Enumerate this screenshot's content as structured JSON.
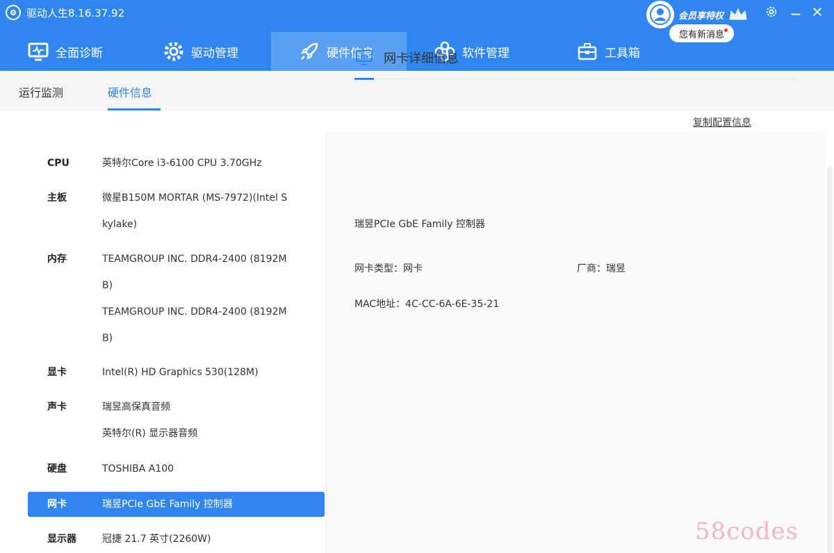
{
  "app": {
    "title": "驱动人生8.16.37.92"
  },
  "user": {
    "member_label": "会员享特权",
    "message": "您有新消息"
  },
  "main_tabs": [
    {
      "label": "全面诊断",
      "icon": "monitor-icon"
    },
    {
      "label": "驱动管理",
      "icon": "gear-icon"
    },
    {
      "label": "硬件信息",
      "icon": "rocket-icon"
    },
    {
      "label": "软件管理",
      "icon": "clover-icon"
    },
    {
      "label": "工具箱",
      "icon": "toolbox-icon"
    }
  ],
  "sub_tabs": [
    {
      "label": "运行监测"
    },
    {
      "label": "硬件信息"
    }
  ],
  "copy_config": "复制配置信息",
  "hardware": [
    {
      "label": "CPU",
      "lines": [
        "英特尔Core i3-6100 CPU 3.70GHz"
      ]
    },
    {
      "label": "主板",
      "lines": [
        "微星B150M MORTAR (MS-7972)(Intel S",
        "kylake)"
      ]
    },
    {
      "label": "内存",
      "lines": [
        "TEAMGROUP INC. DDR4-2400 (8192M",
        "B)",
        "TEAMGROUP INC. DDR4-2400 (8192M",
        "B)"
      ]
    },
    {
      "label": "显卡",
      "lines": [
        "Intel(R) HD Graphics 530(128M)"
      ]
    },
    {
      "label": "声卡",
      "lines": [
        "瑞昱高保真音频",
        "英特尔(R) 显示器音频"
      ]
    },
    {
      "label": "硬盘",
      "lines": [
        "TOSHIBA A100"
      ]
    },
    {
      "label": "网卡",
      "lines": [
        "瑞昱PCIe GbE Family 控制器"
      ],
      "active": true
    },
    {
      "label": "显示器",
      "lines": [
        "冠捷 21.7 英寸(2260W)"
      ]
    }
  ],
  "detail": {
    "heading": "网卡详细信息",
    "device_name": "瑞昱PCIe GbE Family 控制器",
    "type": "网卡类型：网卡",
    "vendor": "厂商：瑞昱",
    "mac": "MAC地址：4C-CC-6A-6E-35-21"
  },
  "watermark": "58codes",
  "colors": {
    "accent": "#2f86f0",
    "active_tab": "#5aa0f2"
  }
}
